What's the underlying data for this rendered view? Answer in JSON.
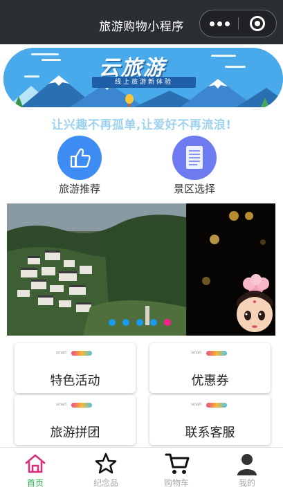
{
  "nav": {
    "title": "旅游购物小程序"
  },
  "banner": {
    "title": "云旅游",
    "subtitle": "线上旅游新体验"
  },
  "slogan": "让兴趣不再孤单,让爱好不再流浪!",
  "features": [
    {
      "label": "旅游推荐",
      "icon": "thumbs-up-icon",
      "color": "#3d8df5"
    },
    {
      "label": "景区选择",
      "icon": "document-icon",
      "color": "#6e7bf0"
    }
  ],
  "carousel": {
    "dot_colors": [
      "#1a9bf0",
      "#1a9bf0",
      "#1a9bf0",
      "#1a9bf0",
      "#ff1f8a"
    ],
    "active_index": 4
  },
  "cards": [
    {
      "label": "特色活动",
      "brand": "smart"
    },
    {
      "label": "优惠券",
      "brand": "smart"
    },
    {
      "label": "旅游拼团",
      "brand": "smart"
    },
    {
      "label": "联系客服",
      "brand": "smart"
    }
  ],
  "tabbar": {
    "items": [
      {
        "label": "首页",
        "icon": "home-icon",
        "active": true
      },
      {
        "label": "纪念品",
        "icon": "star-icon",
        "active": false
      },
      {
        "label": "购物车",
        "icon": "cart-icon",
        "active": false
      },
      {
        "label": "我的",
        "icon": "user-icon",
        "active": false
      }
    ],
    "active_color": "#22ad4a",
    "inactive_color": "#a8a8a8"
  }
}
